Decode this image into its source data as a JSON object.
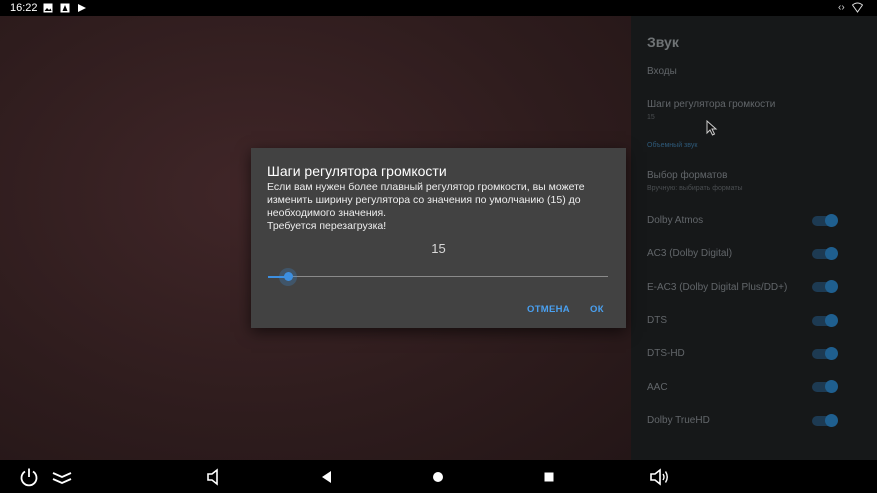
{
  "status_bar": {
    "time": "16:22",
    "icons": [
      "image-icon",
      "notification-icon",
      "play-store-icon"
    ],
    "right_icons": [
      "network-arrows-icon",
      "wifi-icon"
    ]
  },
  "settings": {
    "title": "Звук",
    "items": [
      {
        "label": "Входы"
      },
      {
        "label": "Шаги регулятора громкости",
        "sub": "15"
      },
      {
        "label": "",
        "sub": "Объемный звук"
      },
      {
        "label": "Выбор форматов",
        "sub": "Вручную: выбирать форматы"
      },
      {
        "label": "Dolby Atmos",
        "toggle": true
      },
      {
        "label": "AC3 (Dolby Digital)",
        "toggle": true
      },
      {
        "label": "E-AC3 (Dolby Digital Plus/DD+)",
        "toggle": true
      },
      {
        "label": "DTS",
        "toggle": true
      },
      {
        "label": "DTS-HD",
        "toggle": true
      },
      {
        "label": "AAC",
        "toggle": true
      },
      {
        "label": "Dolby TrueHD",
        "toggle": true
      }
    ]
  },
  "dialog": {
    "title": "Шаги регулятора громкости",
    "message": "Если вам нужен более плавный регулятор громкости, вы можете изменить ширину регулятора со значения по умолчанию (15) до необходимого значения.\nТребуется перезагрузка!",
    "value": "15",
    "slider_fraction": 0.06,
    "cancel_label": "ОТМЕНА",
    "ok_label": "ОК",
    "accent_color": "#3d8fe0"
  },
  "nav_bar": {
    "icons": [
      "power-icon",
      "collapse-icon",
      "volume-down-icon",
      "back-icon",
      "home-icon",
      "recents-icon",
      "volume-up-icon"
    ]
  }
}
